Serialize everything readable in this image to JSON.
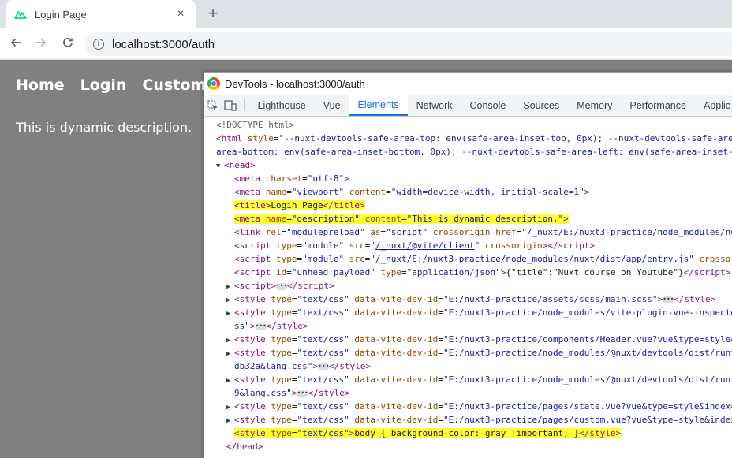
{
  "browser": {
    "tab_title": "Login Page",
    "new_tab": "+",
    "close": "×",
    "url": "localhost:3000/auth"
  },
  "page": {
    "nav": [
      "Home",
      "Login",
      "Custom"
    ],
    "description": "This is dynamic description."
  },
  "devtools": {
    "title": "DevTools - localhost:3000/auth",
    "tabs": [
      "Lighthouse",
      "Vue",
      "Elements",
      "Network",
      "Console",
      "Sources",
      "Memory",
      "Performance",
      "Applic"
    ],
    "active_tab": "Elements"
  },
  "dom": {
    "doctype": "<!DOCTYPE html>",
    "html_open_1": "--nuxt-devtools-safe-area-top: env(safe-area-inset-top, 0px); --nuxt-devtools-safe-area",
    "html_open_2": "area-bottom: env(safe-area-inset-bottom, 0px); --nuxt-devtools-safe-area-left: env(safe-area-inset-l",
    "charset": "utf-8",
    "viewport": "width=device-width, initial-scale=1",
    "title_text": "Login Page",
    "meta_desc": "This is dynamic description.",
    "link_href": "/_nuxt/E:/nuxt3-practice/node_modules/nu",
    "script1_src": "/_nuxt/@vite/client",
    "script2_src": "/_nuxt/E:/nuxt3-practice/node_modules/nuxt/dist/app/entry.js",
    "script3_text": "{\"title\":\"Nuxt course on Youtube\"}",
    "style1": "E:/nuxt3-practice/assets/scss/main.scss",
    "style2": "E:/nuxt3-practice/node_modules/vite-plugin-vue-inspecto",
    "style2b": "ss\"",
    "style3": "E:/nuxt3-practice/components/Header.vue?vue&type=style&",
    "style4": "E:/nuxt3-practice/node_modules/@nuxt/devtools/dist/runt",
    "style4b": "db32a&lang.css\"",
    "style5": "E:/nuxt3-practice/node_modules/@nuxt/devtools/dist/runt",
    "style5b": "9&lang.css\"",
    "style6": "E:/nuxt3-practice/pages/state.vue?vue&type=style&index=",
    "style7": "E:/nuxt3-practice/pages/custom.vue?vue&type=style&index",
    "style8_text": "body { background-color: gray !important; }"
  }
}
